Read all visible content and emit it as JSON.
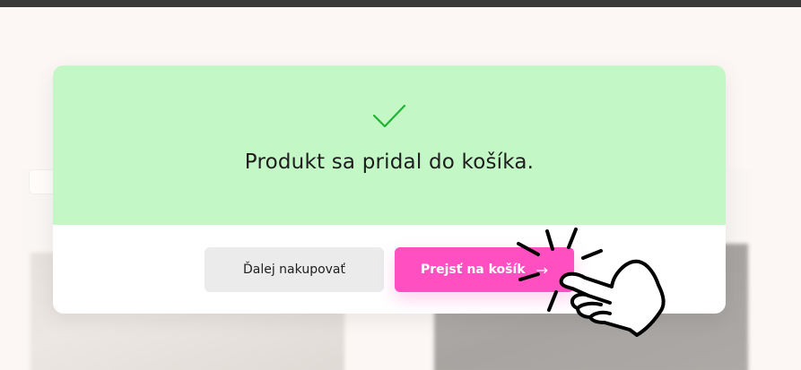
{
  "modal": {
    "message": "Produkt sa pridal do košíka.",
    "continue_label": "Ďalej nakupovať",
    "cart_label": "Prejsť na košík",
    "cart_arrow": "→"
  },
  "icons": {
    "check": "check-icon",
    "hand": "pointing-hand-icon"
  },
  "colors": {
    "success_bg": "#c3f7c6",
    "check": "#22b233",
    "primary": "#ff4fc0",
    "secondary": "#ebebeb"
  }
}
